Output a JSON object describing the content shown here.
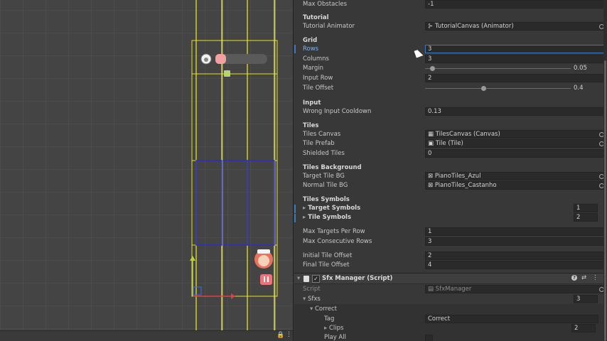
{
  "colors": {
    "accent": "#3a79bb",
    "scene_yellow": "#e6e21a",
    "scene_blue": "#2a2ec8",
    "scene_red": "#e04040"
  },
  "scene": {
    "lock_icon": "lock-icon",
    "toolbar_icons": [
      "lock-icon",
      "menu-icon"
    ]
  },
  "inspector": {
    "max_obstacles": {
      "label": "Max Obstacles",
      "value": "-1"
    },
    "tutorial": {
      "header": "Tutorial",
      "animator": {
        "label": "Tutorial Animator",
        "value": "TutorialCanvas (Animator)"
      }
    },
    "grid": {
      "header": "Grid",
      "rows": {
        "label": "Rows",
        "value": "3"
      },
      "columns": {
        "label": "Columns",
        "value": "3"
      },
      "margin": {
        "label": "Margin",
        "value": "0.05",
        "fraction": 0.05
      },
      "input_row": {
        "label": "Input Row",
        "value": "2"
      },
      "tile_offset": {
        "label": "Tile Offset",
        "value": "0.4",
        "fraction": 0.4
      }
    },
    "input": {
      "header": "Input",
      "wrong_input_cooldown": {
        "label": "Wrong Input Cooldown",
        "value": "0.13"
      }
    },
    "tiles": {
      "header": "Tiles",
      "canvas": {
        "label": "Tiles Canvas",
        "value": "TilesCanvas (Canvas)"
      },
      "prefab": {
        "label": "Tile Prefab",
        "value": "Tile (Tile)"
      },
      "shielded": {
        "label": "Shielded Tiles",
        "value": "0"
      }
    },
    "tiles_background": {
      "header": "Tiles Background",
      "target": {
        "label": "Target Tile BG",
        "value": "PianoTiles_Azul"
      },
      "normal": {
        "label": "Normal Tile BG",
        "value": "PianoTiles_Castanho"
      }
    },
    "tiles_symbols": {
      "header": "Tiles Symbols",
      "target_symbols": {
        "label": "Target Symbols",
        "value": "1"
      },
      "tile_symbols": {
        "label": "Tile Symbols",
        "value": "2"
      }
    },
    "max_targets_per_row": {
      "label": "Max Targets Per Row",
      "value": "1"
    },
    "max_consecutive_rows": {
      "label": "Max Consecutive Rows",
      "value": "3"
    },
    "initial_tile_offset": {
      "label": "Initial Tile Offset",
      "value": "2"
    },
    "final_tile_offset": {
      "label": "Final Tile Offset",
      "value": "4"
    },
    "sfx_manager": {
      "title": "Sfx Manager (Script)",
      "script": {
        "label": "Script",
        "value": "SfxManager"
      },
      "sfxs": {
        "label": "Sfxs",
        "value": "3"
      },
      "correct": {
        "label": "Correct",
        "tag": {
          "label": "Tag",
          "value": "Correct"
        },
        "clips": {
          "label": "Clips",
          "value": "2"
        },
        "play_all": {
          "label": "Play All"
        }
      }
    }
  }
}
